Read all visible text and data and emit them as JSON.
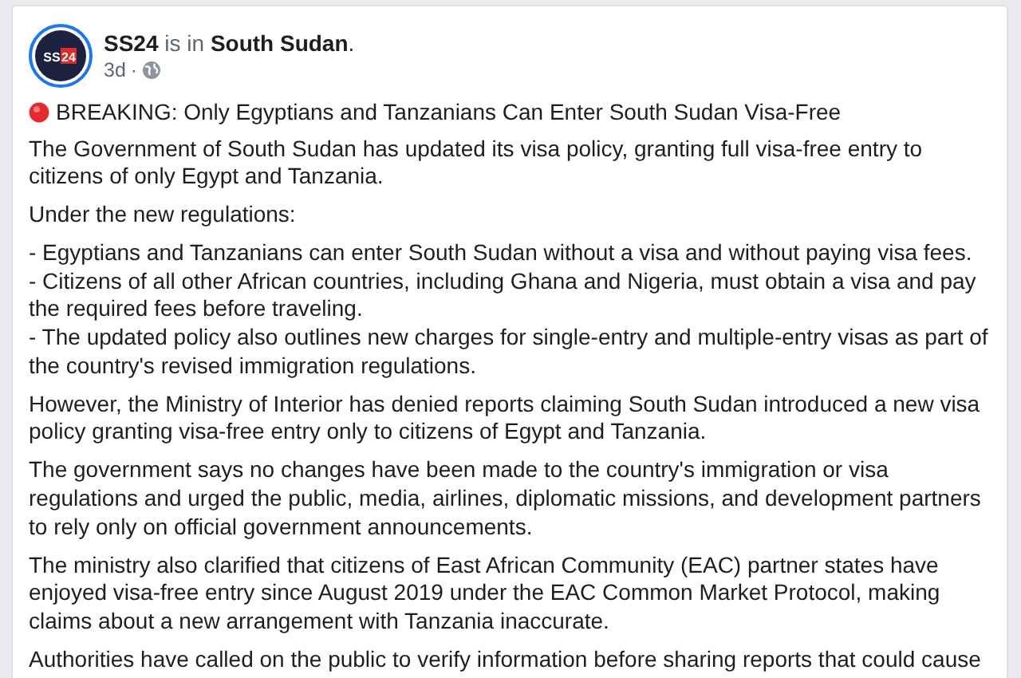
{
  "post": {
    "author": "SS24",
    "connector": "is in",
    "location": "South Sudan",
    "trailing": ".",
    "avatar": {
      "part1": "SS",
      "part2": "24"
    },
    "time": "3d",
    "separator": "·",
    "title": "BREAKING: Only Egyptians and Tanzanians Can Enter South Sudan Visa-Free",
    "paragraphs": [
      {
        "lines": [
          "The Government of South Sudan has updated its visa policy, granting full visa-free entry to citizens of only Egypt and Tanzania."
        ]
      },
      {
        "lines": [
          "Under the new regulations:"
        ]
      },
      {
        "lines": [
          "- Egyptians and Tanzanians can enter South Sudan without a visa and without paying visa fees.",
          "- Citizens of all other African countries, including Ghana and Nigeria, must obtain a visa and pay the required fees before traveling.",
          "- The updated policy also outlines new charges for single-entry and multiple-entry visas as part of the country's revised immigration regulations."
        ]
      },
      {
        "lines": [
          "However, the Ministry of Interior has denied reports claiming South Sudan introduced a new visa policy granting visa-free entry only to citizens of Egypt and Tanzania."
        ]
      },
      {
        "lines": [
          "The government says no changes have been made to the country's immigration or visa regulations and urged the public, media, airlines, diplomatic missions, and development partners to rely only on official government announcements."
        ]
      },
      {
        "lines": [
          "The ministry also clarified that citizens of East African Community (EAC) partner states have enjoyed visa-free entry since August 2019 under the EAC Common Market Protocol, making claims about a new arrangement with Tanzania inaccurate."
        ]
      },
      {
        "lines": [
          "Authorities have called on the public to verify information before sharing reports that could cause"
        ]
      }
    ]
  }
}
